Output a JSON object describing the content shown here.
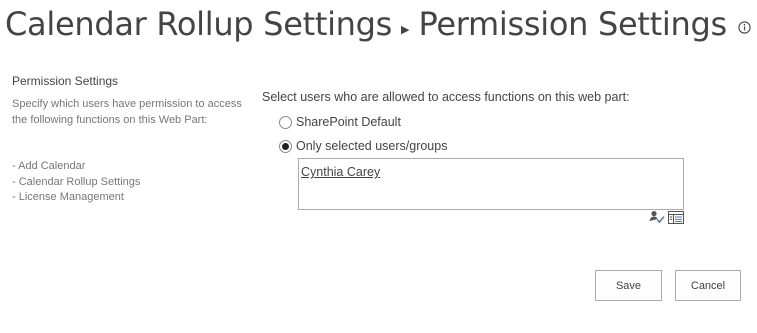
{
  "header": {
    "breadcrumb": [
      "Calendar Rollup Settings",
      "Permission Settings"
    ],
    "separator_icon": "arrow-right-icon",
    "info_icon": "info-icon"
  },
  "section": {
    "title": "Permission Settings",
    "description": "Specify which users have permission to access the following functions on this Web Part:",
    "functions": [
      "- Add Calendar",
      "- Calendar Rollup Settings",
      "- License Management"
    ]
  },
  "form": {
    "prompt": "Select users who are allowed to access functions on this web part:",
    "options": [
      {
        "label": "SharePoint Default",
        "selected": false
      },
      {
        "label": "Only selected users/groups",
        "selected": true
      }
    ],
    "people_picker": {
      "users": [
        "Cynthia Carey"
      ],
      "tools": [
        "check-names-icon",
        "browse-directory-icon"
      ]
    }
  },
  "buttons": {
    "save": "Save",
    "cancel": "Cancel"
  }
}
